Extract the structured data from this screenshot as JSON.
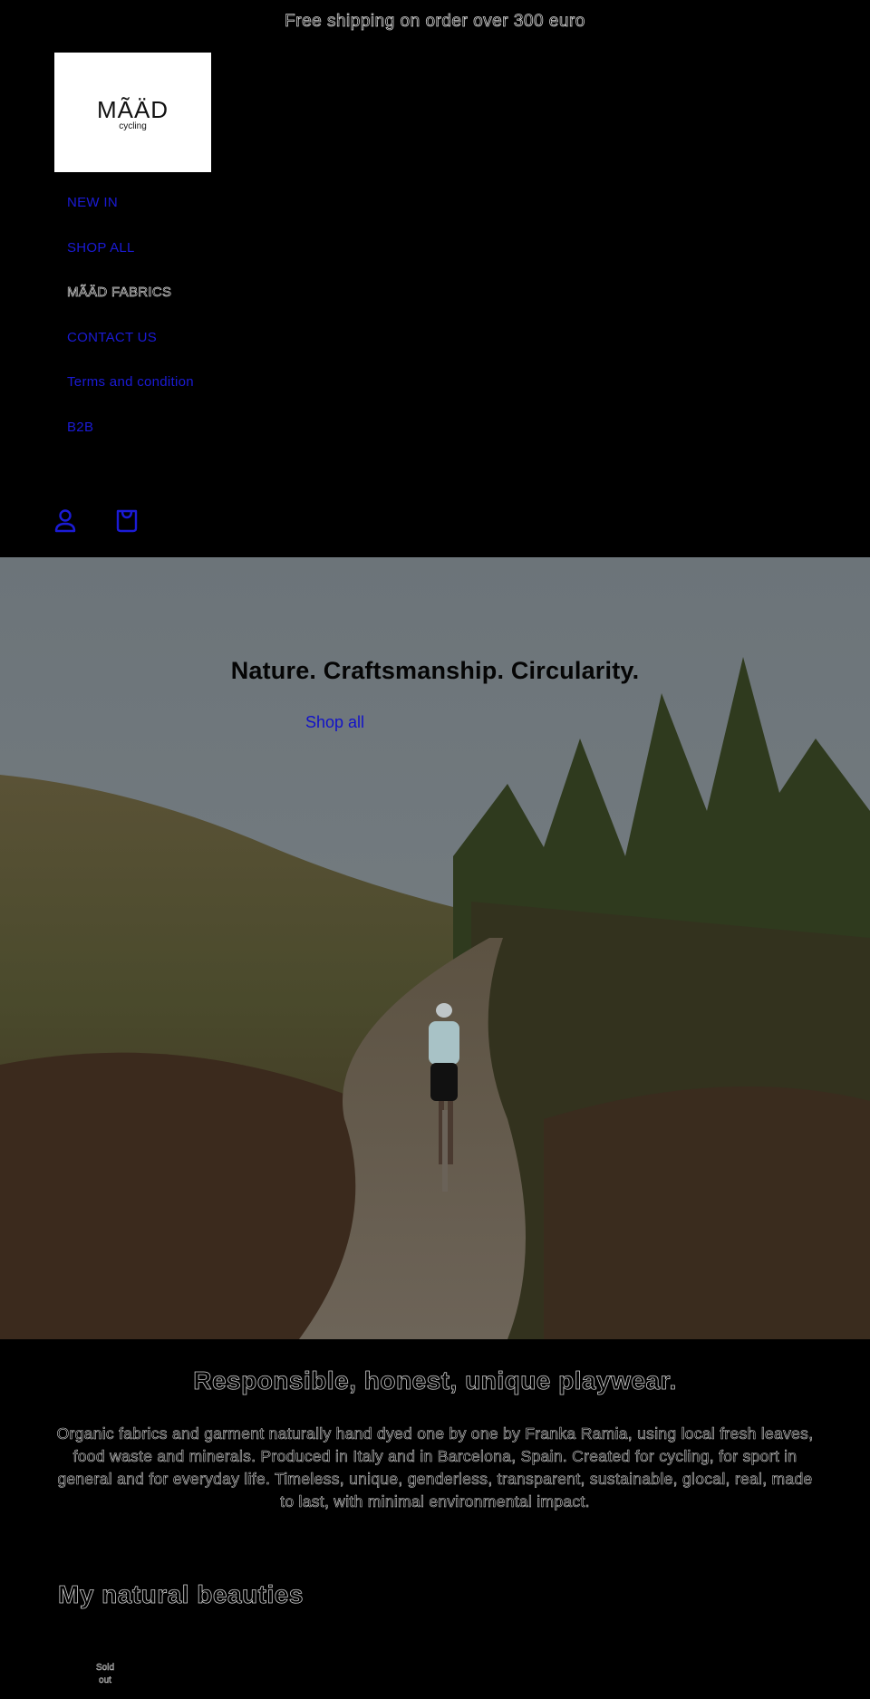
{
  "announcement": {
    "text": "Free shipping on order over 300 euro"
  },
  "header": {
    "logo": {
      "main": "MÃÄD",
      "sub": "cycling"
    },
    "nav": [
      {
        "label": "NEW IN"
      },
      {
        "label": "SHOP ALL"
      },
      {
        "label": "MÃÄD FABRICS"
      },
      {
        "label": "CONTACT US"
      },
      {
        "label": "Terms and condition"
      },
      {
        "label": "B2B"
      }
    ],
    "icons": {
      "account": "account-icon",
      "cart": "cart-icon"
    }
  },
  "hero": {
    "title": "Nature. Craftsmanship. Circularity.",
    "link": "Shop all",
    "image_alt": "Cyclist riding on a dirt road through pine forest and hills"
  },
  "about": {
    "title": "Responsible, honest, unique playwear.",
    "text": "Organic fabrics and garment naturally hand dyed one by one by Franka Ramia, using local fresh leaves, food waste and minerals. Produced in Italy and in Barcelona, Spain. Created for cycling, for sport in general and for everyday life. Timeless, unique, genderless, transparent, sustainable, glocal, real, made to last, with minimal environmental impact."
  },
  "collection": {
    "title": "My natural beauties",
    "badge": "Sold out"
  },
  "colors": {
    "background": "#000000",
    "link": "#1b1bd6",
    "outline_text": "#cfcfcf"
  }
}
